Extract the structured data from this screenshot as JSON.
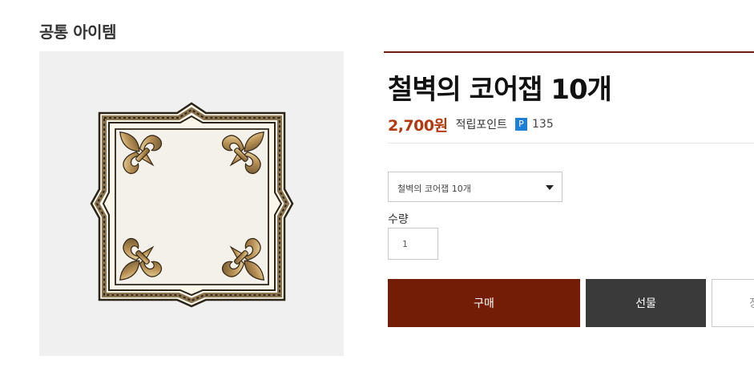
{
  "category": {
    "title": "공통 아이템"
  },
  "product": {
    "name": "철벽의 코어잽 10개",
    "price": "2,700원",
    "points_label": "적립포인트",
    "points_badge": "P",
    "points_value": "135",
    "image_icon": "ornate-frame-icon"
  },
  "option_select": {
    "selected": "철벽의 코어잽 10개"
  },
  "quantity": {
    "label": "수량",
    "value": "1"
  },
  "actions": {
    "buy_label": "구매",
    "gift_label": "선물",
    "cart_label_partial": "장"
  },
  "colors": {
    "accent": "#741d06",
    "price": "#b13a10",
    "gift_button": "#3a3a3a",
    "points_badge": "#1e7fd6"
  }
}
